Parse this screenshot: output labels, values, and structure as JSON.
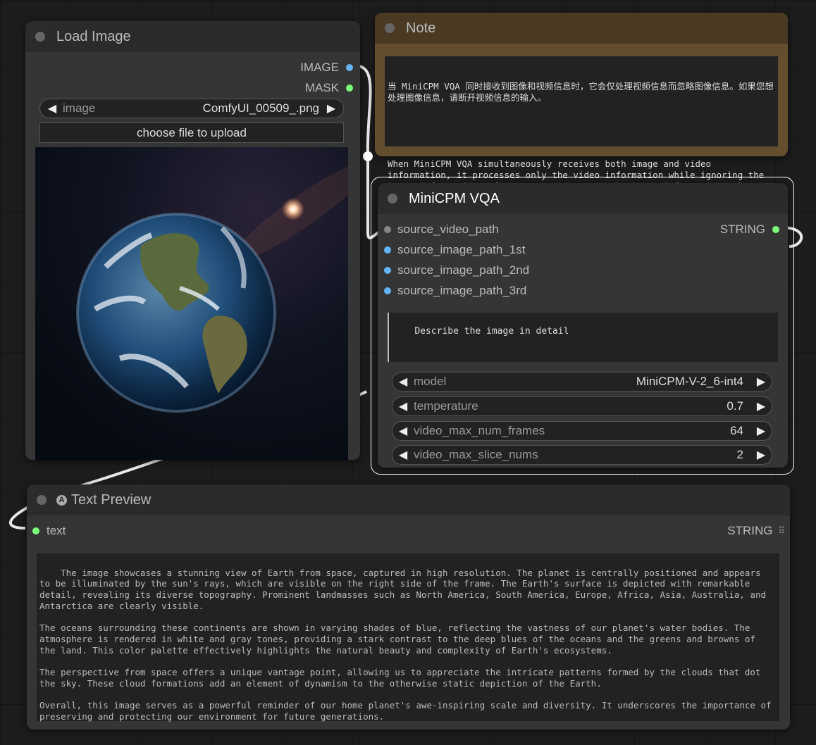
{
  "load_image": {
    "title": "Load Image",
    "outputs": [
      "IMAGE",
      "MASK"
    ],
    "image_widget": {
      "label": "image",
      "value": "ComfyUI_00509_.png"
    },
    "upload_button": "choose file to upload"
  },
  "note": {
    "title": "Note",
    "text_zh": "当 MiniCPM VQA 同时接收到图像和视频信息时，它会仅处理视频信息而忽略图像信息。如果您想处理图像信息，请断开视频信息的输入。",
    "text_en": "When MiniCPM VQA simultaneously receives both image and video information, it processes only the video information while ignoring the image information. If you want to process the image information, please disconnect the input of the video information."
  },
  "minicpm": {
    "title": "MiniCPM VQA",
    "inputs": [
      "source_video_path",
      "source_image_path_1st",
      "source_image_path_2nd",
      "source_image_path_3rd"
    ],
    "output": "STRING",
    "prompt": "Describe the image in detail",
    "widgets": [
      {
        "label": "model",
        "value": "MiniCPM-V-2_6-int4"
      },
      {
        "label": "temperature",
        "value": "0.7"
      },
      {
        "label": "video_max_num_frames",
        "value": "64"
      },
      {
        "label": "video_max_slice_nums",
        "value": "2"
      }
    ]
  },
  "text_preview": {
    "title": "Text Preview",
    "badge": "A",
    "input": "text",
    "output": "STRING",
    "content": "The image showcases a stunning view of Earth from space, captured in high resolution. The planet is centrally positioned and appears to be illuminated by the sun's rays, which are visible on the right side of the frame. The Earth's surface is depicted with remarkable detail, revealing its diverse topography. Prominent landmasses such as North America, South America, Europe, Africa, Asia, Australia, and Antarctica are clearly visible.\n\nThe oceans surrounding these continents are shown in varying shades of blue, reflecting the vastness of our planet's water bodies. The atmosphere is rendered in white and gray tones, providing a stark contrast to the deep blues of the oceans and the greens and browns of the land. This color palette effectively highlights the natural beauty and complexity of Earth's ecosystems.\n\nThe perspective from space offers a unique vantage point, allowing us to appreciate the intricate patterns formed by the clouds that dot the sky. These cloud formations add an element of dynamism to the otherwise static depiction of the Earth.\n\nOverall, this image serves as a powerful reminder of our home planet's awe-inspiring scale and diversity. It underscores the importance of preserving and protecting our environment for future generations."
  },
  "colors": {
    "canvas": "#1c1c1c",
    "node_body": "#353535",
    "node_title": "#2b2b2b",
    "note_body": "#634e2d",
    "note_title": "#4a3a24",
    "slot_image": "#64b5f6",
    "slot_string": "#7cff7c"
  }
}
